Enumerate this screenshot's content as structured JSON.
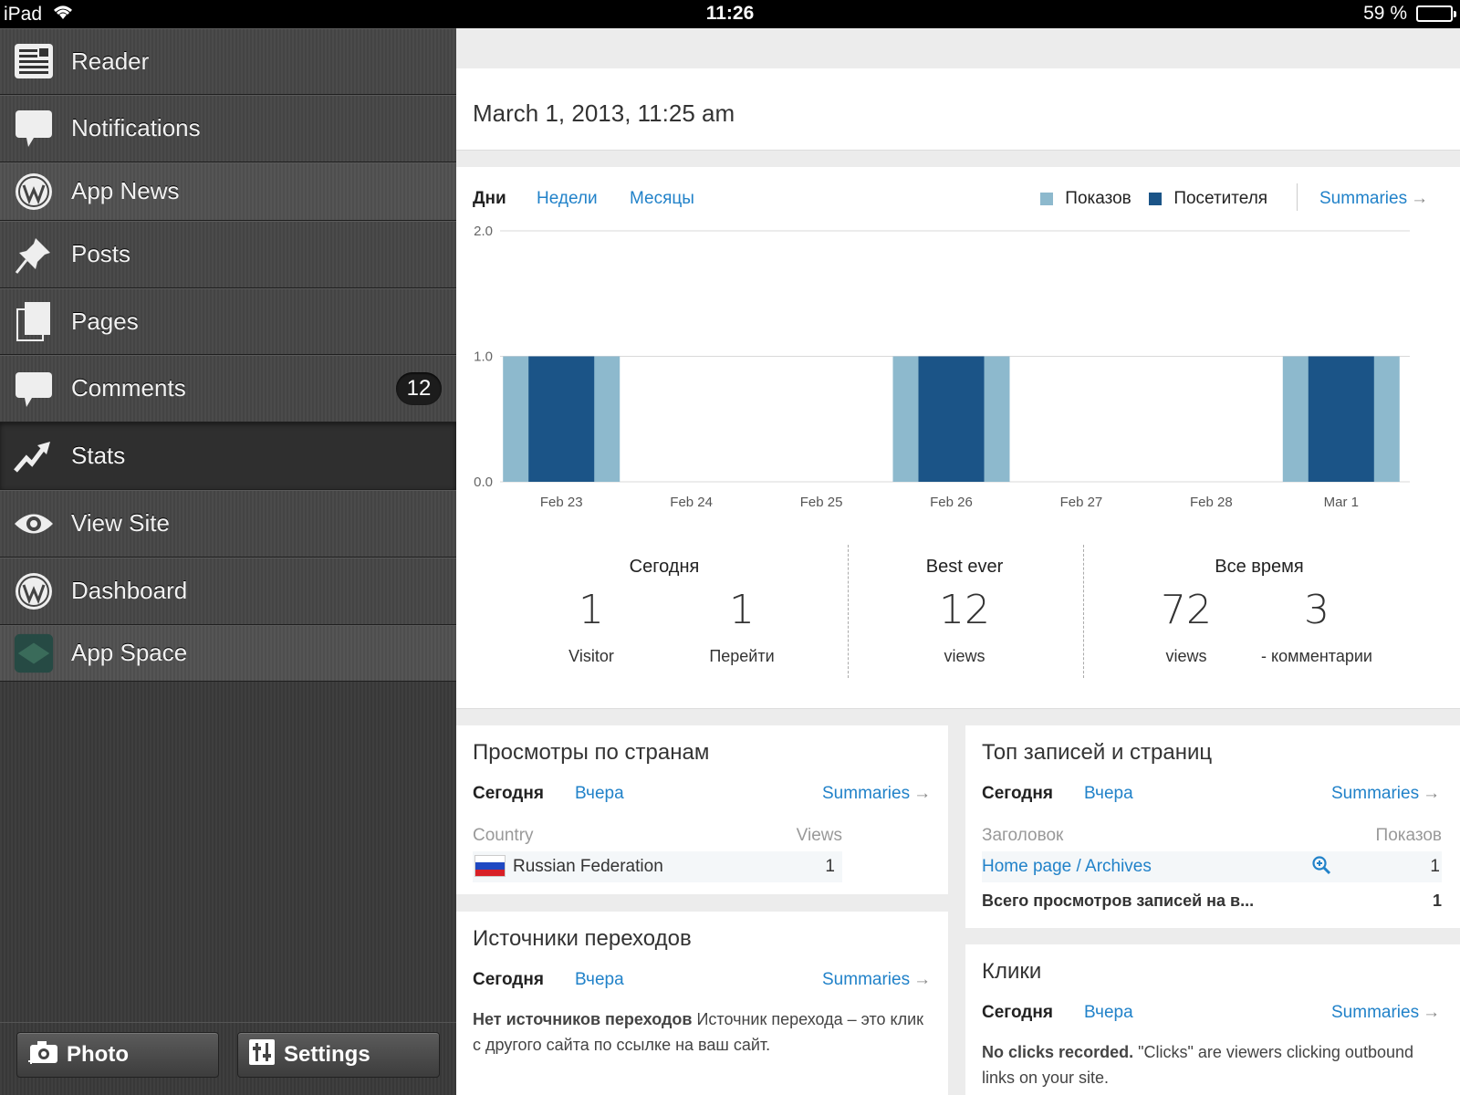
{
  "status_bar": {
    "device": "iPad",
    "time": "11:26",
    "battery": "59 %",
    "battery_level": 0.59
  },
  "sidebar": {
    "items": [
      {
        "label": "Reader",
        "icon": "reader-icon"
      },
      {
        "label": "Notifications",
        "icon": "speech-bubble-icon"
      },
      {
        "label": "App News",
        "icon": "wordpress-logo-icon"
      },
      {
        "label": "Posts",
        "icon": "pushpin-icon"
      },
      {
        "label": "Pages",
        "icon": "pages-icon"
      },
      {
        "label": "Comments",
        "icon": "comment-bubble-icon",
        "badge": "12"
      },
      {
        "label": "Stats",
        "icon": "trending-up-icon"
      },
      {
        "label": "View Site",
        "icon": "eye-icon"
      },
      {
        "label": "Dashboard",
        "icon": "wordpress-logo-icon"
      },
      {
        "label": "App Space",
        "icon": "app-space-icon"
      }
    ],
    "active": "Stats",
    "bottom": {
      "photo_label": "Photo",
      "settings_label": "Settings"
    }
  },
  "header": {
    "date": "March 1, 2013, 11:25 am"
  },
  "chart_controls": {
    "tabs": [
      "Дни",
      "Недели",
      "Месяцы"
    ],
    "active_tab": "Дни",
    "summaries_label": "Summaries"
  },
  "chart_data": {
    "type": "bar",
    "categories": [
      "Feb 23",
      "Feb 24",
      "Feb 25",
      "Feb 26",
      "Feb 27",
      "Feb 28",
      "Mar 1"
    ],
    "series": [
      {
        "name": "Показов",
        "values": [
          1,
          0,
          0,
          1,
          0,
          0,
          1
        ],
        "color": "#8db9cd"
      },
      {
        "name": "Посетителя",
        "values": [
          1,
          0,
          0,
          1,
          0,
          0,
          1
        ],
        "color": "#1b5487"
      }
    ],
    "ylim": [
      0,
      2
    ],
    "yticks": [
      "0.0",
      "1.0",
      "2.0"
    ],
    "grid": true,
    "legend": "top-right"
  },
  "summary": {
    "today": {
      "title": "Сегодня",
      "visitors": "1",
      "visitors_label": "Visitor",
      "views": "1",
      "views_label": "Перейти"
    },
    "best": {
      "title": "Best ever",
      "views": "12",
      "views_label": "views"
    },
    "all_time": {
      "title": "Все время",
      "views": "72",
      "views_label": "views",
      "comments": "3",
      "comments_label": "- комментарии"
    }
  },
  "countries": {
    "title": "Просмотры по странам",
    "tab_today": "Сегодня",
    "tab_yesterday": "Вчера",
    "summaries": "Summaries",
    "col_country": "Country",
    "col_views": "Views",
    "rows": [
      {
        "country": "Russian Federation",
        "views": "1"
      }
    ]
  },
  "top_posts": {
    "title": "Топ записей и страниц",
    "tab_today": "Сегодня",
    "tab_yesterday": "Вчера",
    "summaries": "Summaries",
    "col_title": "Заголовок",
    "col_views": "Показов",
    "rows": [
      {
        "title": "Home page / Archives",
        "views": "1"
      }
    ],
    "total_label": "Всего просмотров записей на в...",
    "total_value": "1"
  },
  "referrers": {
    "title": "Источники переходов",
    "tab_today": "Сегодня",
    "tab_yesterday": "Вчера",
    "summaries": "Summaries",
    "empty_bold": "Нет источников переходов",
    "empty_text": "Источник перехода – это клик с другого сайта по ссылке на ваш сайт."
  },
  "clicks": {
    "title": "Клики",
    "tab_today": "Сегодня",
    "tab_yesterday": "Вчера",
    "summaries": "Summaries",
    "empty_bold": "No clicks recorded.",
    "empty_text": "\"Clicks\" are viewers clicking outbound links on your site."
  }
}
